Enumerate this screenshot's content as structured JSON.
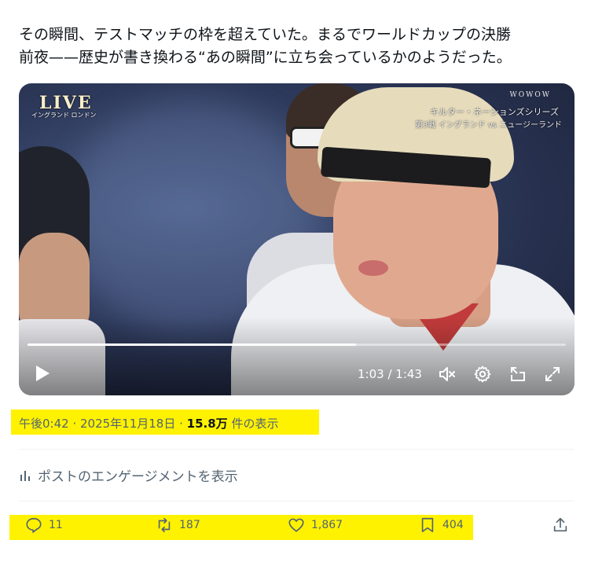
{
  "post": {
    "line1": "その瞬間、テストマッチの枠を超えていた。まるでワールドカップの決勝",
    "line2": "前夜——歴史が書き換わる“あの瞬間”に立ち会っているかのようだった。"
  },
  "video": {
    "overlay_live": "LIVE",
    "overlay_location": "イングランド ロンドン",
    "overlay_channel": "WOWOW",
    "overlay_series": "キルター・ネーションズシリーズ",
    "overlay_match": "第3戦 イングランド vs ニュージーランド",
    "time": "1:03 / 1:43",
    "progress": 0.61
  },
  "meta": {
    "time": "午後0:42",
    "sep1": " · ",
    "date": "2025年11月18日",
    "sep2": " · ",
    "views": "15.8万",
    "views_suffix": " 件の表示"
  },
  "engagement_link": "ポストのエンゲージメントを表示",
  "actions": {
    "replies": "11",
    "reposts": "187",
    "likes": "1,867",
    "bookmarks": "404"
  },
  "colors": {
    "highlight": "#fff200",
    "secondary_text": "#536471",
    "primary_text": "#0f1419"
  }
}
